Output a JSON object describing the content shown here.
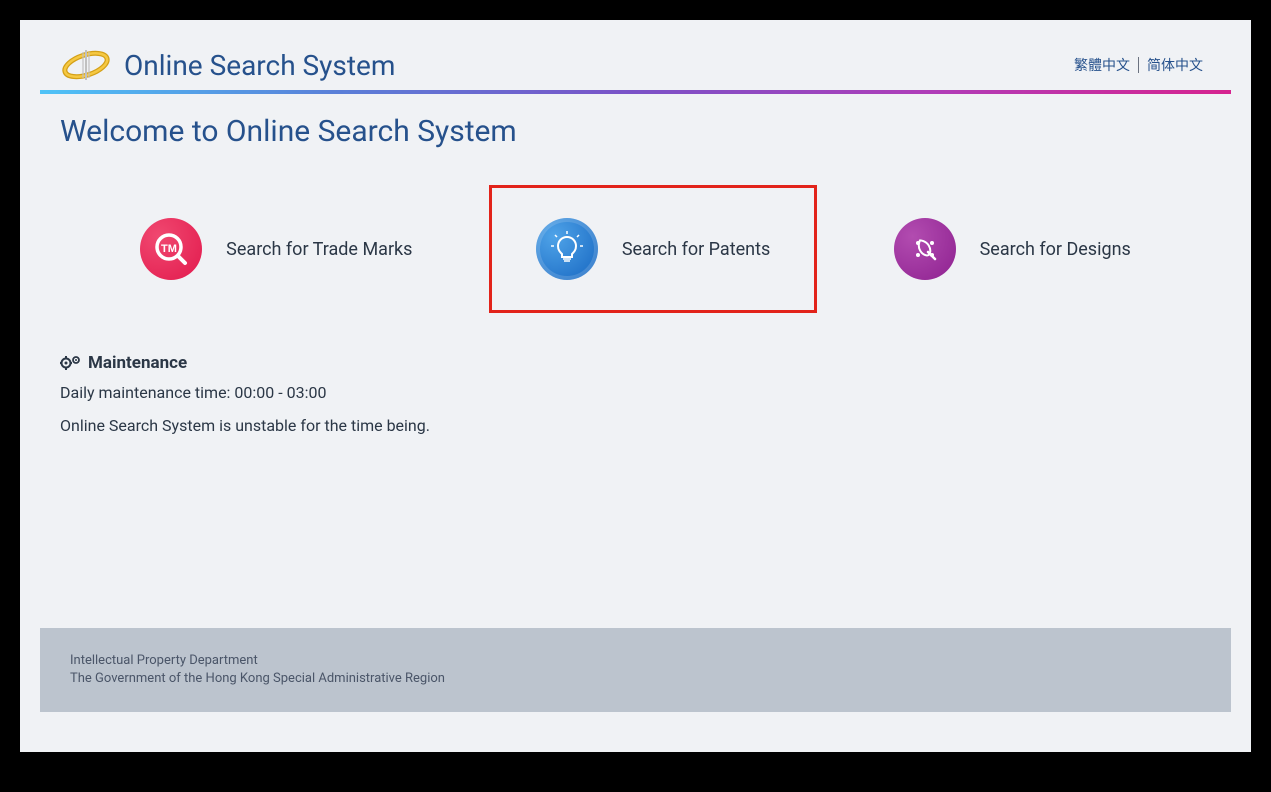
{
  "header": {
    "site_title": "Online Search System",
    "lang_traditional": "繁體中文",
    "lang_simplified": "简体中文"
  },
  "main": {
    "welcome_title": "Welcome to Online Search System",
    "cards": [
      {
        "label": "Search for Trade Marks"
      },
      {
        "label": "Search for Patents"
      },
      {
        "label": "Search for Designs"
      }
    ]
  },
  "maintenance": {
    "heading": "Maintenance",
    "schedule": "Daily maintenance time: 00:00 - 03:00",
    "notice": "Online Search System is unstable for the time being."
  },
  "footer": {
    "line1": "Intellectual Property Department",
    "line2": "The Government of the Hong Kong Special Administrative Region"
  }
}
